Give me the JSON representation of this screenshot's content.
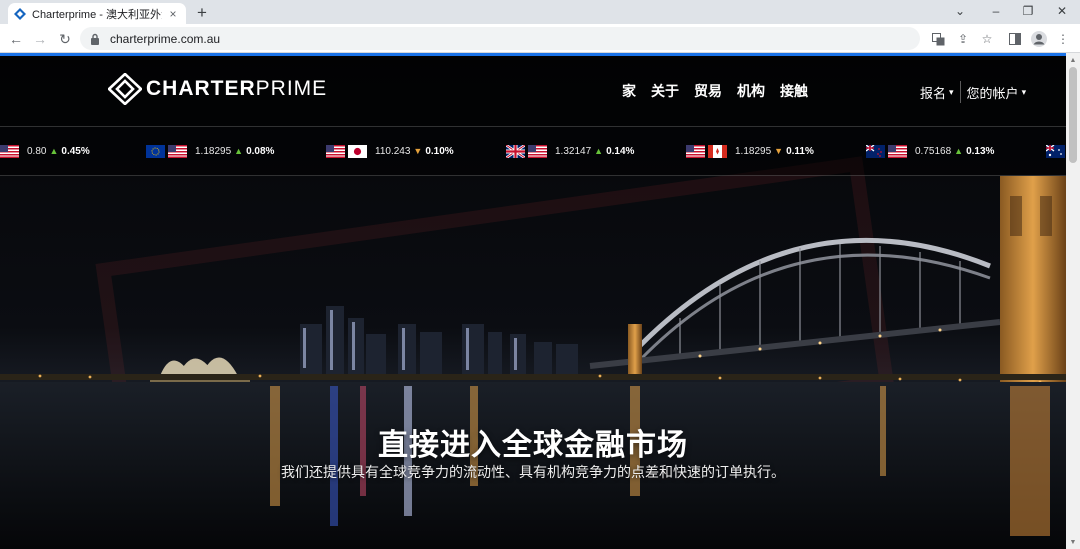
{
  "browser": {
    "tab_title": "Charterprime - 澳大利亚外汇经",
    "url": "charterprime.com.au",
    "new_tab_symbol": "+",
    "close_symbol": "×"
  },
  "site": {
    "logo_bold": "CHARTER",
    "logo_light": "PRIME",
    "nav": [
      "家",
      "关于",
      "贸易",
      "机构",
      "接触"
    ],
    "signup_label": "报名",
    "account_label": "您的帐户"
  },
  "ticker": [
    {
      "price": "0.80",
      "direction": "up",
      "change": "0.45%"
    },
    {
      "price": "1.18295",
      "direction": "up",
      "change": "0.08%"
    },
    {
      "price": "110.243",
      "direction": "down",
      "change": "0.10%"
    },
    {
      "price": "1.32147",
      "direction": "up",
      "change": "0.14%"
    },
    {
      "price": "1.18295",
      "direction": "down",
      "change": "0.11%"
    },
    {
      "price": "0.75168",
      "direction": "up",
      "change": "0.13%"
    }
  ],
  "hero": {
    "title": "直接进入全球金融市场",
    "subtitle": "我们还提供具有全球竞争力的流动性、具有机构竞争力的点差和快速的订单执行。"
  },
  "colors": {
    "accent": "#1b73e8",
    "up": "#67c23a",
    "down": "#e6a23c"
  },
  "icons": {
    "favicon": "charterprime-favicon",
    "lock": "lock-icon",
    "translate": "translate-icon",
    "share": "share-icon",
    "bookmark": "star-icon",
    "sidepanel": "side-panel-icon",
    "profile": "profile-icon",
    "menu": "kebab-menu-icon"
  }
}
